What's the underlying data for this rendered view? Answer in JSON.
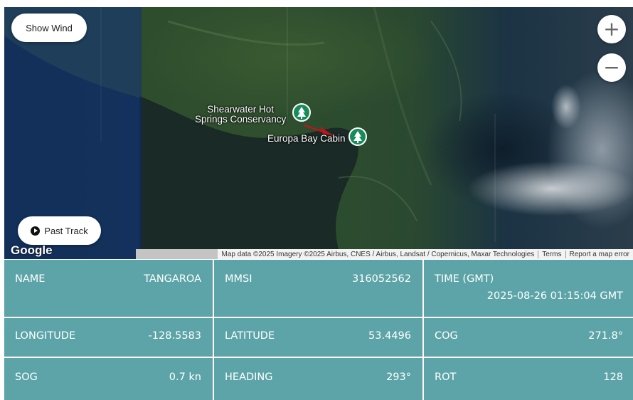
{
  "map": {
    "show_wind_label": "Show Wind",
    "past_track_label": "Past Track",
    "zoom_in": "+",
    "zoom_out": "−",
    "places": {
      "shearwater_line1": "Shearwater Hot",
      "shearwater_line2": "Springs Conservancy",
      "europa": "Europa Bay Cabin"
    },
    "google_logo": "Google",
    "attribution": {
      "data": "Map data ©2025 Imagery ©2025 Airbus, CNES / Airbus, Landsat / Copernicus, Maxar Technologies",
      "terms": "Terms",
      "report": "Report a map error"
    },
    "vessel_marker_color": "#c0141b",
    "place_marker_color": "#188b5a"
  },
  "vessel": {
    "name": {
      "label": "NAME",
      "value": "TANGAROA"
    },
    "mmsi": {
      "label": "MMSI",
      "value": "316052562"
    },
    "time": {
      "label": "TIME (GMT)",
      "value": "2025-08-26 01:15:04 GMT"
    },
    "longitude": {
      "label": "LONGITUDE",
      "value": "-128.5583"
    },
    "latitude": {
      "label": "LATITUDE",
      "value": "53.4496"
    },
    "cog": {
      "label": "COG",
      "value": "271.8°"
    },
    "sog": {
      "label": "SOG",
      "value": "0.7 kn"
    },
    "heading": {
      "label": "HEADING",
      "value": "293°"
    },
    "rot": {
      "label": "ROT",
      "value": "128"
    }
  }
}
